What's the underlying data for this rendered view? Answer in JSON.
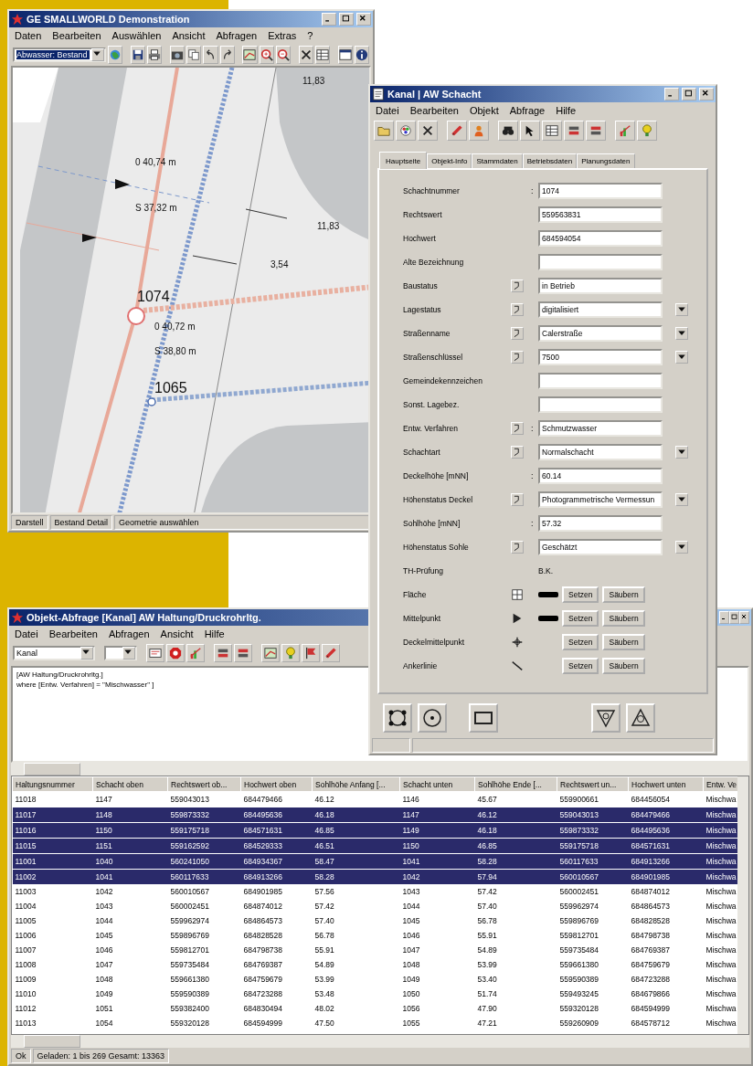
{
  "main_window": {
    "title": "GE SMALLWORLD Demonstration",
    "menu": [
      "Daten",
      "Bearbeiten",
      "Auswählen",
      "Ansicht",
      "Abfragen",
      "Extras",
      "?"
    ],
    "layer_select": "Abwasser: Bestand",
    "map": {
      "labels": [
        "11,83",
        "0 40,74 m",
        "S 37,32 m",
        "11,83",
        "3,54",
        "1074",
        "0 40,72 m",
        "S 38,80 m",
        "1065"
      ]
    },
    "status_bar": [
      "Darstell",
      "Bestand Detail",
      "Geometrie auswählen"
    ]
  },
  "object_window": {
    "title": "Kanal | AW Schacht",
    "menu": [
      "Datei",
      "Bearbeiten",
      "Objekt",
      "Abfrage",
      "Hilfe"
    ],
    "tabs": [
      {
        "label": "Hauptseite",
        "selected": true
      },
      {
        "label": "Objekt-Info",
        "selected": false
      },
      {
        "label": "Stammdaten",
        "selected": false
      },
      {
        "label": "Betriebsdaten",
        "selected": false
      },
      {
        "label": "Planungsdaten",
        "selected": false
      }
    ],
    "fields": [
      {
        "kind": "input",
        "label": "Schachtnummer",
        "separator": ":",
        "value": "1074",
        "help": false,
        "dropdown": false
      },
      {
        "kind": "input",
        "label": "Rechtswert",
        "value": "559563831",
        "help": false,
        "dropdown": false
      },
      {
        "kind": "input",
        "label": "Hochwert",
        "value": "684594054",
        "help": false,
        "dropdown": false
      },
      {
        "kind": "input",
        "label": "Alte Bezeichnung",
        "help": false,
        "dropdown": false
      },
      {
        "kind": "input",
        "label": "Baustatus",
        "value": "in Betrieb",
        "help": true,
        "dropdown": false
      },
      {
        "kind": "input",
        "label": "Lagestatus",
        "value": "digitalisiert",
        "help": true,
        "dropdown": true
      },
      {
        "kind": "input",
        "label": "Straßenname",
        "value": "Calerstraße",
        "help": true,
        "dropdown": true
      },
      {
        "kind": "input",
        "label": "Straßenschlüssel",
        "value": "7500",
        "help": true,
        "dropdown": true
      },
      {
        "kind": "input",
        "label": "Gemeindekennzeichen",
        "help": false,
        "dropdown": false
      },
      {
        "kind": "input",
        "label": "Sonst. Lagebez.",
        "help": false,
        "dropdown": false
      },
      {
        "kind": "input",
        "label": "Entw. Verfahren",
        "separator": ":",
        "value": "Schmutzwasser",
        "help": true,
        "dropdown": false
      },
      {
        "kind": "input",
        "label": "Schachtart",
        "value": "Normalschacht",
        "help": true,
        "dropdown": true
      },
      {
        "kind": "input",
        "label": "Deckelhöhe [mNN]",
        "separator": ":",
        "value": "60.14",
        "help": false,
        "dropdown": false
      },
      {
        "kind": "input",
        "label": "Höhenstatus Deckel",
        "value": "Photogrammetrische Vermessun",
        "help": true,
        "dropdown": true
      },
      {
        "kind": "input",
        "label": "Sohlhöhe [mNN]",
        "separator": ":",
        "value": "57.32",
        "help": false,
        "dropdown": false
      },
      {
        "kind": "input",
        "label": "Höhenstatus Sohle",
        "value": "Geschätzt",
        "help": true,
        "dropdown": true
      },
      {
        "kind": "note",
        "label": "TH-Prüfung",
        "value": "B.K."
      },
      {
        "kind": "geometry",
        "label": "Fläche",
        "swatch": true,
        "buttons": [
          "Setzen",
          "Säubern"
        ]
      },
      {
        "kind": "geometry",
        "label": "Mittelpunkt",
        "swatch": true,
        "buttons": [
          "Setzen",
          "Säubern"
        ]
      },
      {
        "kind": "geometry",
        "label": "Deckelmittelpunkt",
        "swatch": false,
        "buttons": [
          "Setzen",
          "Säubern"
        ]
      },
      {
        "kind": "geometry",
        "label": "Ankerlinie",
        "swatch": false,
        "buttons": [
          "Setzen",
          "Säubern"
        ]
      }
    ]
  },
  "query_window": {
    "title": "Objekt-Abfrage [Kanal] AW Haltung/Druckrohrltg.",
    "menu": [
      "Datei",
      "Bearbeiten",
      "Abfragen",
      "Ansicht",
      "Hilfe"
    ],
    "class_select": "Kanal",
    "query": [
      "[AW Haltung/Druckrohrltg.]",
      "where [Entw. Verfahren] = \"Mischwasser\" ]"
    ],
    "table": {
      "columns": [
        "Haltungsnummer",
        "Schacht oben",
        "Rechtswert ob...",
        "Hochwert oben",
        "Sohlhöhe Anfang [...",
        "Schacht unten",
        "Sohlhöhe Ende [...",
        "Rechtswert un...",
        "Hochwert unten",
        "Entw. Ve"
      ],
      "rows": [
        {
          "selected": false,
          "cells": [
            "11018",
            "1147",
            "559043013",
            "684479466",
            "46.12",
            "1146",
            "45.67",
            "559900661",
            "684456054",
            "Mischwa"
          ]
        },
        {
          "selected": true,
          "cells": [
            "11017",
            "1148",
            "559873332",
            "684495636",
            "46.18",
            "1147",
            "46.12",
            "559043013",
            "684479466",
            "Mischwa"
          ]
        },
        {
          "selected": true,
          "cells": [
            "11016",
            "1150",
            "559175718",
            "684571631",
            "46.85",
            "1149",
            "46.18",
            "559873332",
            "684495636",
            "Mischwa"
          ]
        },
        {
          "selected": true,
          "cells": [
            "11015",
            "1151",
            "559162592",
            "684529333",
            "46.51",
            "1150",
            "46.85",
            "559175718",
            "684571631",
            "Mischwa"
          ]
        },
        {
          "selected": true,
          "cells": [
            "11001",
            "1040",
            "560241050",
            "684934367",
            "58.47",
            "1041",
            "58.28",
            "560117633",
            "684913266",
            "Mischwa"
          ]
        },
        {
          "selected": true,
          "cells": [
            "11002",
            "1041",
            "560117633",
            "684913266",
            "58.28",
            "1042",
            "57.94",
            "560010567",
            "684901985",
            "Mischwa"
          ]
        },
        {
          "selected": false,
          "cells": [
            "11003",
            "1042",
            "560010567",
            "684901985",
            "57.56",
            "1043",
            "57.42",
            "560002451",
            "684874012",
            "Mischwa"
          ]
        },
        {
          "selected": false,
          "cells": [
            "11004",
            "1043",
            "560002451",
            "684874012",
            "57.42",
            "1044",
            "57.40",
            "559962974",
            "684864573",
            "Mischwa"
          ]
        },
        {
          "selected": false,
          "cells": [
            "11005",
            "1044",
            "559962974",
            "684864573",
            "57.40",
            "1045",
            "56.78",
            "559896769",
            "684828528",
            "Mischwa"
          ]
        },
        {
          "selected": false,
          "cells": [
            "11006",
            "1045",
            "559896769",
            "684828528",
            "56.78",
            "1046",
            "55.91",
            "559812701",
            "684798738",
            "Mischwa"
          ]
        },
        {
          "selected": false,
          "cells": [
            "11007",
            "1046",
            "559812701",
            "684798738",
            "55.91",
            "1047",
            "54.89",
            "559735484",
            "684769387",
            "Mischwa"
          ]
        },
        {
          "selected": false,
          "cells": [
            "11008",
            "1047",
            "559735484",
            "684769387",
            "54.89",
            "1048",
            "53.99",
            "559661380",
            "684759679",
            "Mischwa"
          ]
        },
        {
          "selected": false,
          "cells": [
            "11009",
            "1048",
            "559661380",
            "684759679",
            "53.99",
            "1049",
            "53.40",
            "559590389",
            "684723288",
            "Mischwa"
          ]
        },
        {
          "selected": false,
          "cells": [
            "11010",
            "1049",
            "559590389",
            "684723288",
            "53.48",
            "1050",
            "51.74",
            "559493245",
            "684679866",
            "Mischwa"
          ]
        },
        {
          "selected": false,
          "cells": [
            "11012",
            "1051",
            "559382400",
            "684830494",
            "48.02",
            "1056",
            "47.90",
            "559320128",
            "684594999",
            "Mischwa"
          ]
        },
        {
          "selected": false,
          "cells": [
            "11013",
            "1054",
            "559320128",
            "684594999",
            "47.50",
            "1055",
            "47.21",
            "559260909",
            "684578712",
            "Mischwa"
          ]
        }
      ]
    },
    "status_bar": [
      "Ok",
      "Geladen: 1 bis 269 Gesamt: 13363"
    ]
  }
}
